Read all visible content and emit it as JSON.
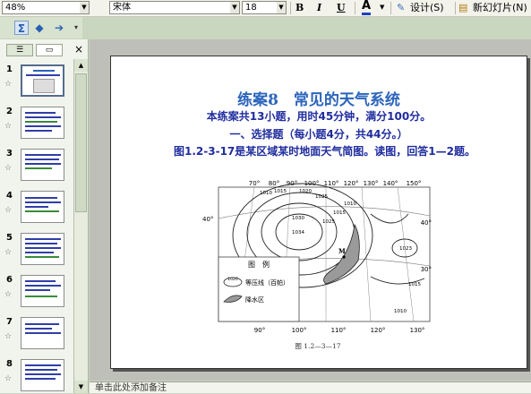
{
  "toolbar": {
    "zoom": "48%",
    "font_name": "宋体",
    "font_size": "18",
    "bold_label": "B",
    "italic_label": "I",
    "underline_label": "U",
    "font_color_label": "A",
    "design_label": "设计(S)",
    "new_slide_label": "新幻灯片(N)"
  },
  "toolbar2": {
    "icons": [
      "sigma-icon",
      "back-arrow-icon",
      "forward-arrow-icon"
    ]
  },
  "panel": {
    "close_label": "×",
    "slides": [
      {
        "num": "1",
        "star": "☆"
      },
      {
        "num": "2",
        "star": "☆"
      },
      {
        "num": "3",
        "star": "☆"
      },
      {
        "num": "4",
        "star": "☆"
      },
      {
        "num": "5",
        "star": "☆"
      },
      {
        "num": "6",
        "star": "☆"
      },
      {
        "num": "7",
        "star": "☆"
      },
      {
        "num": "8",
        "star": "☆"
      }
    ]
  },
  "slide": {
    "title": "练案8　常见的天气系统",
    "line1": "本练案共13小题，用时45分钟，满分100分。",
    "line2": "一、选择题（每小题4分，共44分。）",
    "line3": "图1.2-3-17是某区域某时地面天气简图。读图，回答1—2题。",
    "map": {
      "top_lon": [
        "70°",
        "80°",
        "90°",
        "100°",
        "110°",
        "120°",
        "130°",
        "140°",
        "150°"
      ],
      "bottom_lon": [
        "90°",
        "100°",
        "110°",
        "120°",
        "130°"
      ],
      "left_lat": "40°",
      "right_lat": [
        "40°",
        "30°"
      ],
      "isobars": [
        "1010",
        "1015",
        "1020",
        "1025",
        "1030",
        "1034",
        "1025",
        "1015",
        "1010",
        "1023",
        "1015",
        "1010"
      ],
      "point_label": "M",
      "legend_title": "图　例",
      "legend_isobar_sample": "1020",
      "legend_isobar": "等压线（百帕）",
      "legend_rain": "降水区",
      "caption": "图 1.2—3—17"
    }
  },
  "notes_placeholder": "单击此处添加备注"
}
